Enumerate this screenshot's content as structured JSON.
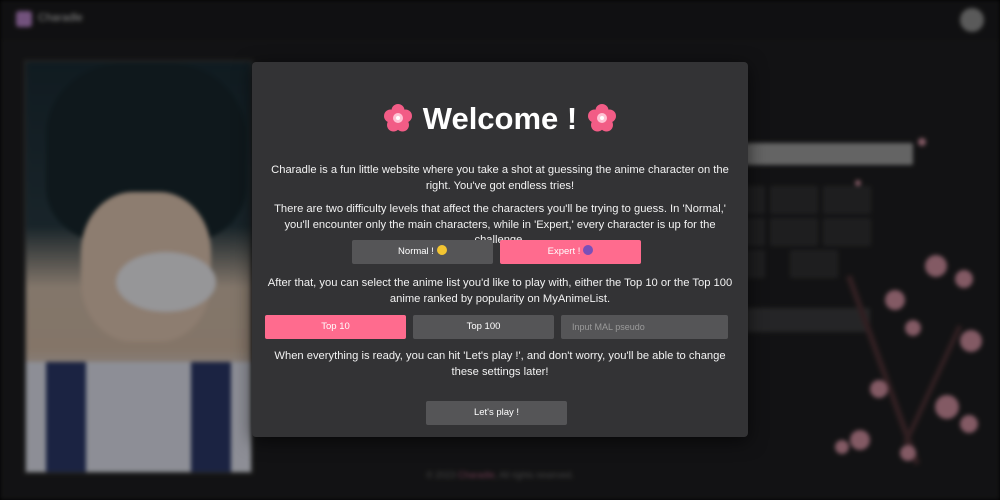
{
  "app": {
    "title": "Charadle",
    "footer_prefix": "© 2023 ",
    "footer_link": "Charadle",
    "footer_suffix": ", All rights reserved."
  },
  "modal": {
    "title": "Welcome !",
    "intro": "Charadle is a fun little website where you take a shot at guessing the anime character on the right. You've got endless tries!",
    "difficulty_text": "There are two difficulty levels that affect the characters you'll be trying to guess. In 'Normal,' you'll encounter only the main characters, while in 'Expert,' every character is up for the challenge.",
    "difficulty_buttons": {
      "normal": "Normal !",
      "expert": "Expert !"
    },
    "list_text": "After that, you can select the anime list you'd like to play with, either the Top 10 or the Top 100 anime ranked by popularity on MyAnimeList.",
    "list_buttons": {
      "top10": "Top 10",
      "top100": "Top 100"
    },
    "mal_input": {
      "placeholder": "Input MAL pseudo",
      "value": ""
    },
    "ready_text": "When everything is ready, you can hit 'Let's play !', and don't worry, you'll be able to change these settings later!",
    "play_button": "Let's play !",
    "selected": {
      "difficulty": "Expert",
      "list": "Top 10"
    }
  },
  "icons": {
    "title_left": "cherry-blossom-icon",
    "title_right": "cherry-blossom-icon",
    "normal_emoji": "smiling-face-icon",
    "expert_emoji": "eyes-face-icon",
    "settings": "gear-icon",
    "logo": "app-logo-icon"
  },
  "colors": {
    "accent": "#ff6b8e",
    "modal_bg": "#333335",
    "button_gray": "#555557",
    "page_bg": "#1d1d1f"
  }
}
